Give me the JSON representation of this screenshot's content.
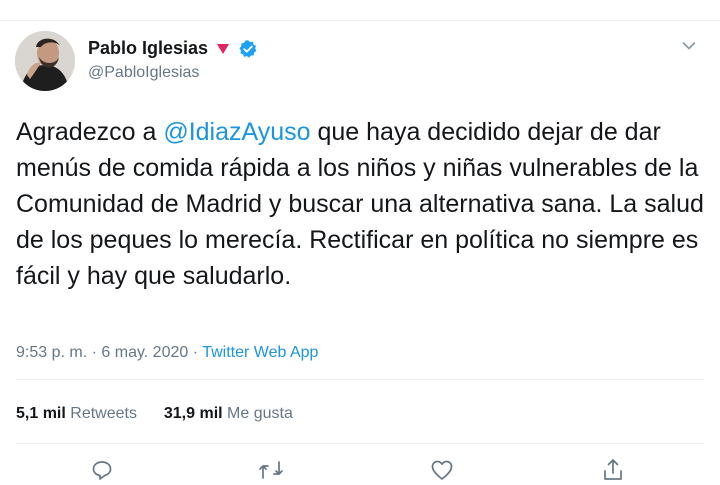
{
  "tweet": {
    "author": {
      "display_name": "Pablo Iglesias",
      "handle": "@PabloIglesias",
      "verified": true
    },
    "text_segments": [
      {
        "type": "text",
        "value": "Agradezco a "
      },
      {
        "type": "mention",
        "value": "@IdiazAyuso"
      },
      {
        "type": "text",
        "value": " que haya decidido dejar de dar menús de comida rápida a los niños y niñas vulnerables de la Comunidad de Madrid y buscar una alternativa sana. La salud de los peques lo merecía. Rectificar en política no siempre es fácil y hay que saludarlo."
      }
    ],
    "meta": {
      "time": "9:53 p. m.",
      "separator": "·",
      "date": "6 may. 2020",
      "source": "Twitter Web App"
    },
    "stats": {
      "retweets_count": "5,1 mil",
      "retweets_label": "Retweets",
      "likes_count": "31,9 mil",
      "likes_label": "Me gusta"
    }
  },
  "actions": [
    {
      "name": "reply-icon",
      "icon": "reply"
    },
    {
      "name": "retweet-icon",
      "icon": "retweet"
    },
    {
      "name": "like-icon",
      "icon": "heart"
    },
    {
      "name": "share-icon",
      "icon": "share"
    }
  ],
  "colors": {
    "link": "#1b95e0",
    "secondary_text": "#657786",
    "verified_badge": "#1da1f2",
    "emoji_triangle": "#e0245e",
    "divider": "#e6ecf0"
  }
}
